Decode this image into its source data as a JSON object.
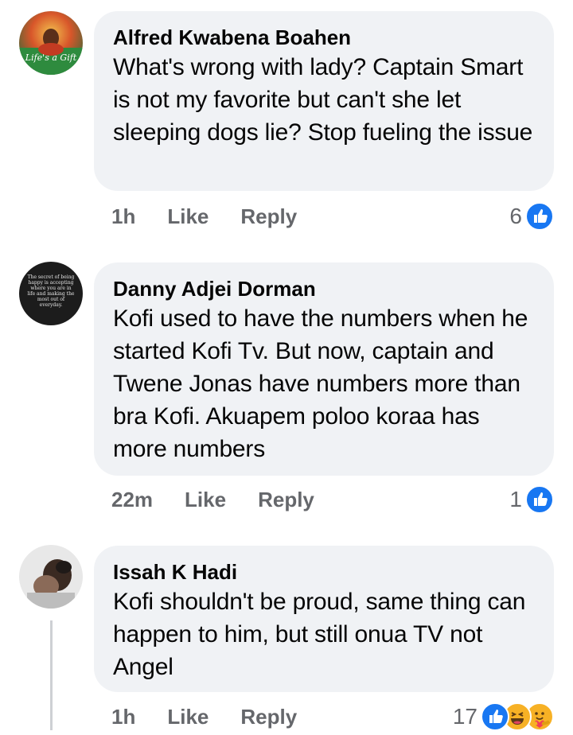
{
  "comments": [
    {
      "author": "Alfred Kwabena Boahen",
      "text": "What's wrong with lady? Captain Smart is not my favorite but can't she let sleeping dogs lie? Stop fueling the issue",
      "time": "1h",
      "like_label": "Like",
      "reply_label": "Reply",
      "reaction_count": "6",
      "reactions": [
        "like-icon"
      ],
      "avatar_text": "Life's a Gift"
    },
    {
      "author": "Danny Adjei Dorman",
      "text": "Kofi used to have the numbers when he started Kofi Tv. But now, captain and Twene Jonas have numbers more than bra Kofi.  Akuapem poloo koraa has more numbers",
      "time": "22m",
      "like_label": "Like",
      "reply_label": "Reply",
      "reaction_count": "1",
      "reactions": [
        "like-icon"
      ],
      "avatar_text": "The secret of being happy is accepting where you are in life and making the most out of everyday."
    },
    {
      "author": "Issah K Hadi",
      "text": "Kofi shouldn't be proud, same thing can happen to him, but still onua TV not Angel",
      "time": "1h",
      "like_label": "Like",
      "reply_label": "Reply",
      "reaction_count": "17",
      "reactions": [
        "like-icon",
        "haha-icon",
        "care-icon"
      ]
    }
  ],
  "colors": {
    "bubble": "#f0f2f5",
    "meta": "#65676b",
    "like_blue": "#1877f2",
    "haha_yellow": "#f7b125"
  }
}
